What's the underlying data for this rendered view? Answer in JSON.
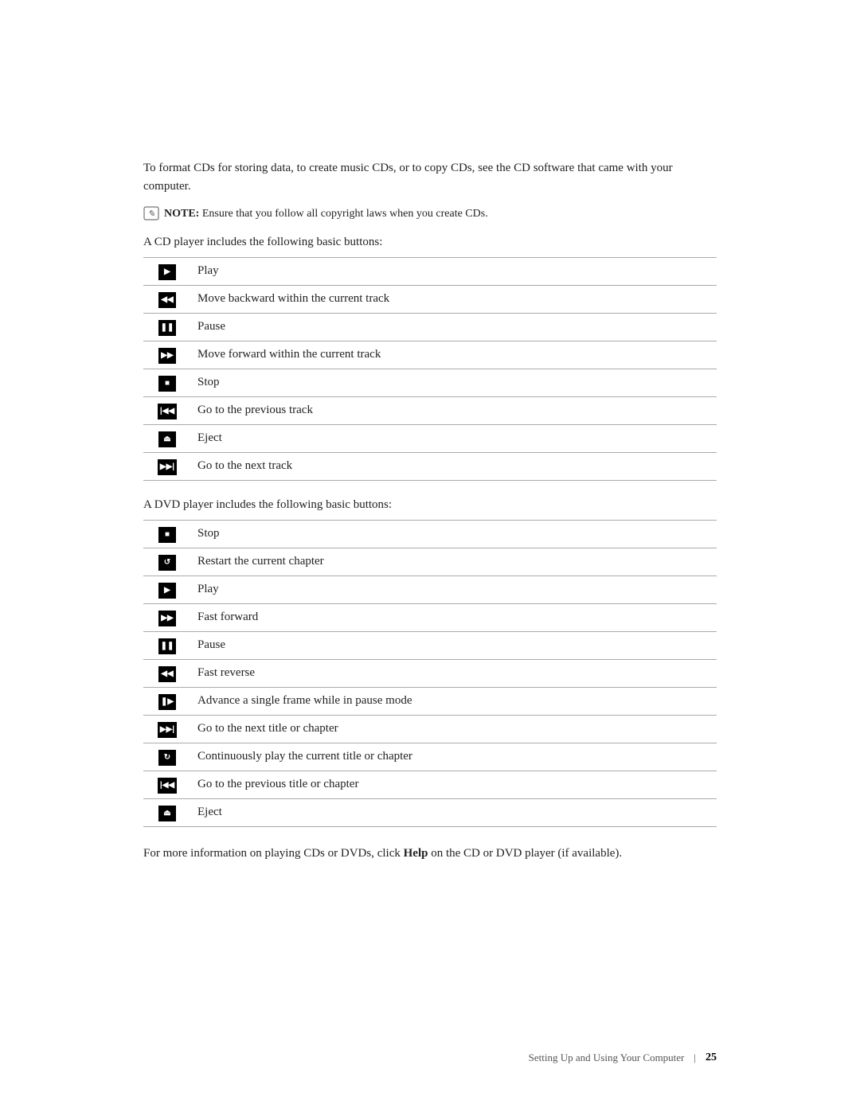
{
  "intro": {
    "text": "To format CDs for storing data, to create music CDs, or to copy CDs, see the CD software that came with your computer."
  },
  "note": {
    "label": "NOTE:",
    "text": "Ensure that you follow all copyright laws when you create CDs."
  },
  "cd_section": {
    "intro": "A CD player includes the following basic buttons:",
    "buttons": [
      {
        "icon": "▶",
        "label": "Play",
        "icon_type": "black"
      },
      {
        "icon": "◀◀",
        "label": "Move backward within the current track",
        "icon_type": "black"
      },
      {
        "icon": "❚❚",
        "label": "Pause",
        "icon_type": "black"
      },
      {
        "icon": "▶▶",
        "label": "Move forward within the current track",
        "icon_type": "black"
      },
      {
        "icon": "■",
        "label": "Stop",
        "icon_type": "black"
      },
      {
        "icon": "|◀◀",
        "label": "Go to the previous track",
        "icon_type": "black"
      },
      {
        "icon": "⏏",
        "label": "Eject",
        "icon_type": "black"
      },
      {
        "icon": "▶▶|",
        "label": "Go to the next track",
        "icon_type": "black"
      }
    ]
  },
  "dvd_section": {
    "intro": "A DVD player includes the following basic buttons:",
    "buttons": [
      {
        "icon": "■",
        "label": "Stop",
        "icon_type": "black"
      },
      {
        "icon": "↺",
        "label": "Restart the current chapter",
        "icon_type": "black"
      },
      {
        "icon": "▶",
        "label": "Play",
        "icon_type": "black"
      },
      {
        "icon": "▶▶",
        "label": "Fast forward",
        "icon_type": "black"
      },
      {
        "icon": "❚❚",
        "label": "Pause",
        "icon_type": "black"
      },
      {
        "icon": "◀◀",
        "label": "Fast reverse",
        "icon_type": "black"
      },
      {
        "icon": "❚▶",
        "label": "Advance a single frame while in pause mode",
        "icon_type": "black"
      },
      {
        "icon": "▶▶|",
        "label": "Go to the next title or chapter",
        "icon_type": "black"
      },
      {
        "icon": "↻",
        "label": "Continuously play the current title or chapter",
        "icon_type": "black"
      },
      {
        "icon": "|◀◀",
        "label": "Go to the previous title or chapter",
        "icon_type": "black"
      },
      {
        "icon": "⏏",
        "label": "Eject",
        "icon_type": "black"
      }
    ]
  },
  "outro": {
    "text": "For more information on playing CDs or DVDs, click ",
    "bold": "Help",
    "text2": " on the CD or DVD player (if available)."
  },
  "footer": {
    "label": "Setting Up and Using Your Computer",
    "divider": "|",
    "page": "25"
  }
}
